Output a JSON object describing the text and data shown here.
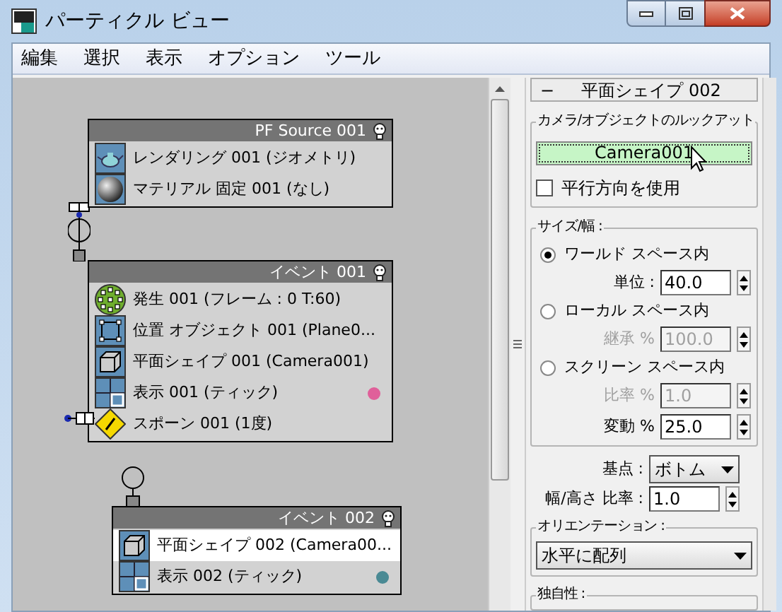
{
  "window": {
    "title": "パーティクル ビュー"
  },
  "menu": [
    "編集",
    "選択",
    "表示",
    "オプション",
    "ツール"
  ],
  "nodes": [
    {
      "title": "PF Source 001",
      "rows": [
        {
          "kind": "render",
          "label": "レンダリング 001 (ジオメトリ)",
          "selected": false
        },
        {
          "kind": "material",
          "label": "マテリアル 固定 001 (なし)",
          "selected": false
        }
      ]
    },
    {
      "title": "イベント 001",
      "rows": [
        {
          "kind": "birth",
          "label": "発生 001 (フレーム : 0 T:60)",
          "selected": false
        },
        {
          "kind": "position",
          "label": "位置 オブジェクト 001 (Plane0...",
          "selected": false
        },
        {
          "kind": "shape",
          "label": "平面シェイプ 001 (Camera001)",
          "selected": false
        },
        {
          "kind": "display",
          "label": "表示 001 (ティック)",
          "selected": false,
          "color": "#e0609a"
        },
        {
          "kind": "spawn",
          "label": "スポーン 001 (1度)",
          "selected": false
        }
      ]
    },
    {
      "title": "イベント 002",
      "rows": [
        {
          "kind": "shape",
          "label": "平面シェイプ 002 (Camera00...",
          "selected": true
        },
        {
          "kind": "display",
          "label": "表示 002 (ティック)",
          "selected": false,
          "color": "#4a8a94"
        }
      ]
    }
  ],
  "panel": {
    "collapse": "−",
    "title": "平面シェイプ 002",
    "lookat": {
      "label": "カメラ/オブジェクトのルックアット",
      "button": "Camera001",
      "checkbox": {
        "label": "平行方向を使用",
        "checked": false
      }
    },
    "size": {
      "label": "サイズ/幅 :",
      "options": [
        {
          "label": "ワールド スペース内",
          "selected": true,
          "field": {
            "label": "単位 :",
            "value": "40.0",
            "disabled": false
          }
        },
        {
          "label": "ローカル スペース内",
          "selected": false,
          "field": {
            "label": "継承 %",
            "value": "100.0",
            "disabled": true
          }
        },
        {
          "label": "スクリーン スペース内",
          "selected": false,
          "field": {
            "label": "比率 %",
            "value": "1.0",
            "disabled": true
          }
        }
      ],
      "variation": {
        "label": "変動 %",
        "value": "25.0"
      }
    },
    "pivot": {
      "label": "基点 :",
      "value": "ボトム"
    },
    "aspect": {
      "label": "幅/高さ 比率 :",
      "value": "1.0"
    },
    "orientation": {
      "label": "オリエンテーション :",
      "value": "水平に配列"
    },
    "uniqueness": {
      "label": "独自性 :"
    }
  }
}
